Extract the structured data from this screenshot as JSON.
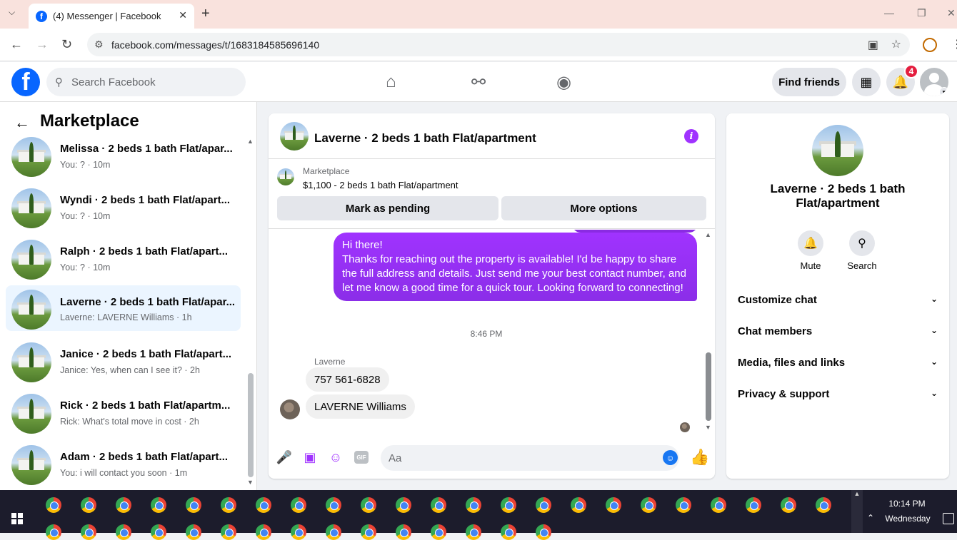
{
  "browser": {
    "tab_title": "(4) Messenger | Facebook",
    "url": "facebook.com/messages/t/1683184585696140"
  },
  "header": {
    "search_placeholder": "Search Facebook",
    "find_friends": "Find friends",
    "notification_count": "4"
  },
  "left": {
    "title": "Marketplace",
    "conversations": [
      {
        "name": "Melissa · 2 beds 1 bath Flat/apar...",
        "preview": "You: ? · 10m",
        "active": false
      },
      {
        "name": "Wyndi · 2 beds 1 bath Flat/apart...",
        "preview": "You: ? · 10m",
        "active": false
      },
      {
        "name": "Ralph · 2 beds 1 bath Flat/apart...",
        "preview": "You: ? · 10m",
        "active": false
      },
      {
        "name": "Laverne · 2 beds 1 bath Flat/apar...",
        "preview": "Laverne: LAVERNE Williams · 1h",
        "active": true
      },
      {
        "name": "Janice · 2 beds 1 bath Flat/apart...",
        "preview": "Janice: Yes, when can I see it? · 2h",
        "active": false
      },
      {
        "name": "Rick · 2 beds 1 bath Flat/apartm...",
        "preview": "Rick: What's total move in cost · 2h",
        "active": false
      },
      {
        "name": "Adam · 2 beds 1 bath Flat/apart...",
        "preview": "You: i will contact you soon · 1m",
        "active": false
      }
    ]
  },
  "chat": {
    "title": "Laverne · 2 beds 1 bath Flat/apartment",
    "listing_source": "Marketplace",
    "listing_desc": "$1,100 - 2 beds 1 bath Flat/apartment",
    "mark_pending": "Mark as pending",
    "more_options": "More options",
    "outgoing_message": "Hi there!\nThanks for reaching out the property is available! I'd be happy to share the full address and details. Just send me your best contact number, and let me know a good time for a quick tour. Looking forward to connecting!",
    "timestamp": "8:46 PM",
    "sender": "Laverne",
    "incoming": [
      "757 561-6828",
      "LAVERNE Williams"
    ],
    "input_placeholder": "Aa",
    "gif_label": "GIF"
  },
  "info": {
    "name": "Laverne · 2 beds 1 bath Flat/apartment",
    "mute": "Mute",
    "search": "Search",
    "sections": [
      "Customize chat",
      "Chat members",
      "Media, files and links",
      "Privacy & support"
    ]
  },
  "taskbar": {
    "time": "10:14 PM",
    "day": "Wednesday"
  },
  "icons": [
    "dropdown-icon",
    "facebook-icon",
    "close-icon",
    "plus-icon",
    "back-icon",
    "forward-icon",
    "reload-icon",
    "site-settings-icon",
    "install-icon",
    "star-icon",
    "profile-icon",
    "search-icon",
    "home-icon",
    "friends-icon",
    "groups-icon",
    "menu-grid-icon",
    "bell-icon",
    "info-icon",
    "mic-icon",
    "image-icon",
    "sticker-icon",
    "gif-icon",
    "emoji-icon",
    "like-icon",
    "chevron-down-icon",
    "chrome-icon",
    "windows-icon"
  ],
  "colors": {
    "messenger_purple": "#a033ff",
    "facebook_blue": "#0866ff",
    "active_bg": "#ebf5ff",
    "badge_red": "#e41e3f"
  }
}
